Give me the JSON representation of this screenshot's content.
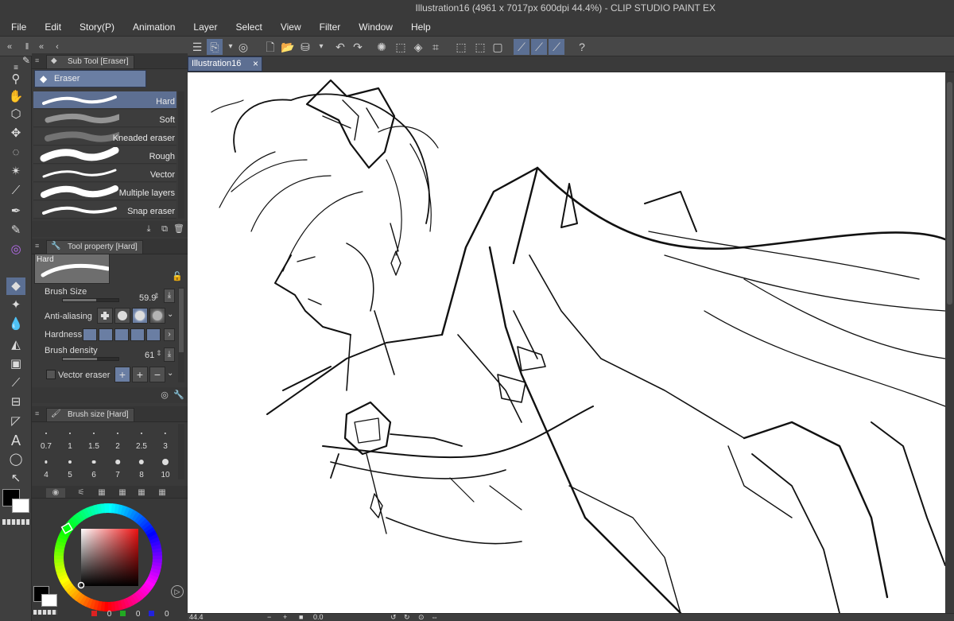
{
  "window": {
    "title": "Illustration16 (4961 x 7017px 600dpi 44.4%) - CLIP STUDIO PAINT EX"
  },
  "menu": [
    "File",
    "Edit",
    "Story(P)",
    "Animation",
    "Layer",
    "Select",
    "View",
    "Filter",
    "Window",
    "Help"
  ],
  "sub_tool": {
    "tab_label": "Sub Tool [Eraser]",
    "group_label": "Eraser",
    "items": [
      "Hard",
      "Soft",
      "Kneaded eraser",
      "Rough",
      "Vector",
      "Multiple layers",
      "Snap eraser"
    ],
    "selected": "Hard"
  },
  "tool_property": {
    "tab_label": "Tool property [Hard]",
    "preview_label": "Hard",
    "brush_size_label": "Brush Size",
    "brush_size_value": "59.9",
    "brush_size_level": 0.6,
    "antialiasing_label": "Anti-aliasing",
    "hardness_label": "Hardness",
    "brush_density_label": "Brush density",
    "brush_density_value": "61",
    "brush_density_level": 0.61,
    "vector_eraser_label": "Vector eraser"
  },
  "brush_size_panel": {
    "tab_label": "Brush size [Hard]",
    "sizes": [
      "0.7",
      "1",
      "1.5",
      "2",
      "2.5",
      "3",
      "4",
      "5",
      "6",
      "7",
      "8",
      "10"
    ]
  },
  "color": {
    "main": "#000000",
    "sub": "#ffffff",
    "r": "0",
    "g": "0",
    "b": "0"
  },
  "canvas": {
    "tab_label": "Illustration16",
    "zoom": "44.4",
    "rotation": "0.0"
  },
  "accent": "#5b6f93"
}
